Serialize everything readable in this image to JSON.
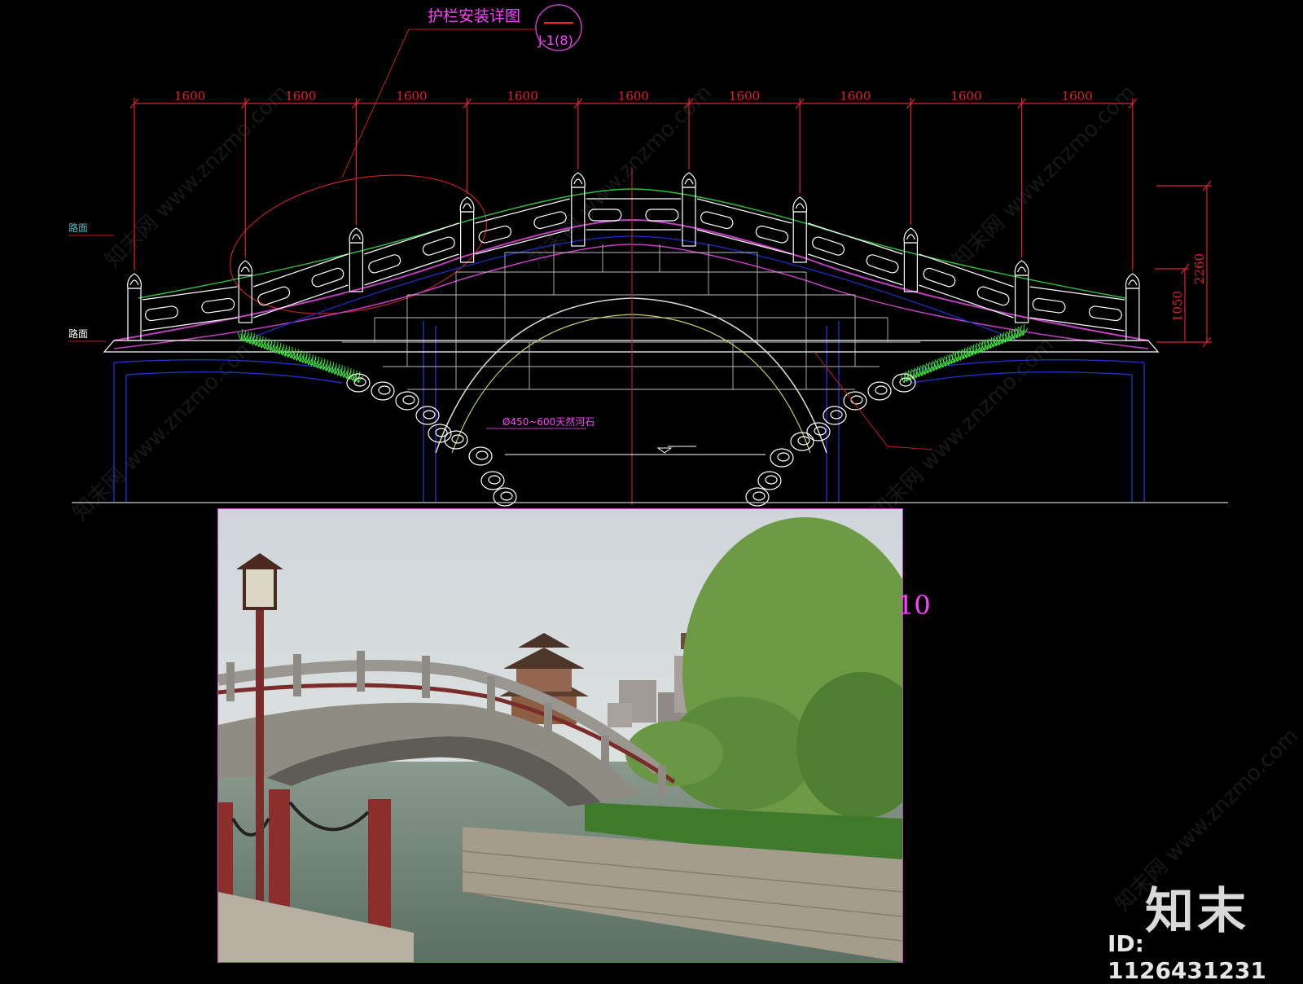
{
  "callout": {
    "title": "护栏安装详图",
    "ref_number": "J-1(8)"
  },
  "spans": [
    "1600",
    "1600",
    "1600",
    "1600",
    "1600",
    "1600",
    "1600",
    "1600",
    "1600"
  ],
  "heights": {
    "total": "2260",
    "railing": "1050"
  },
  "stone_note": "Ø450~600天然河石",
  "left_labels": [
    "路面",
    "路面"
  ],
  "side_number": "10",
  "watermark": {
    "logo": "知末",
    "id": "ID: 1126431231",
    "site": "知末网 www.znzmo.com"
  },
  "colors": {
    "background": "#000000",
    "dimension": "#e02030",
    "railing": "#ffffff",
    "arch_green": "#2fbf3f",
    "arch_magenta": "#c040c0",
    "blue": "#2030c0",
    "grass": "#3fdf3f",
    "callout_text": "#ff40ff"
  }
}
